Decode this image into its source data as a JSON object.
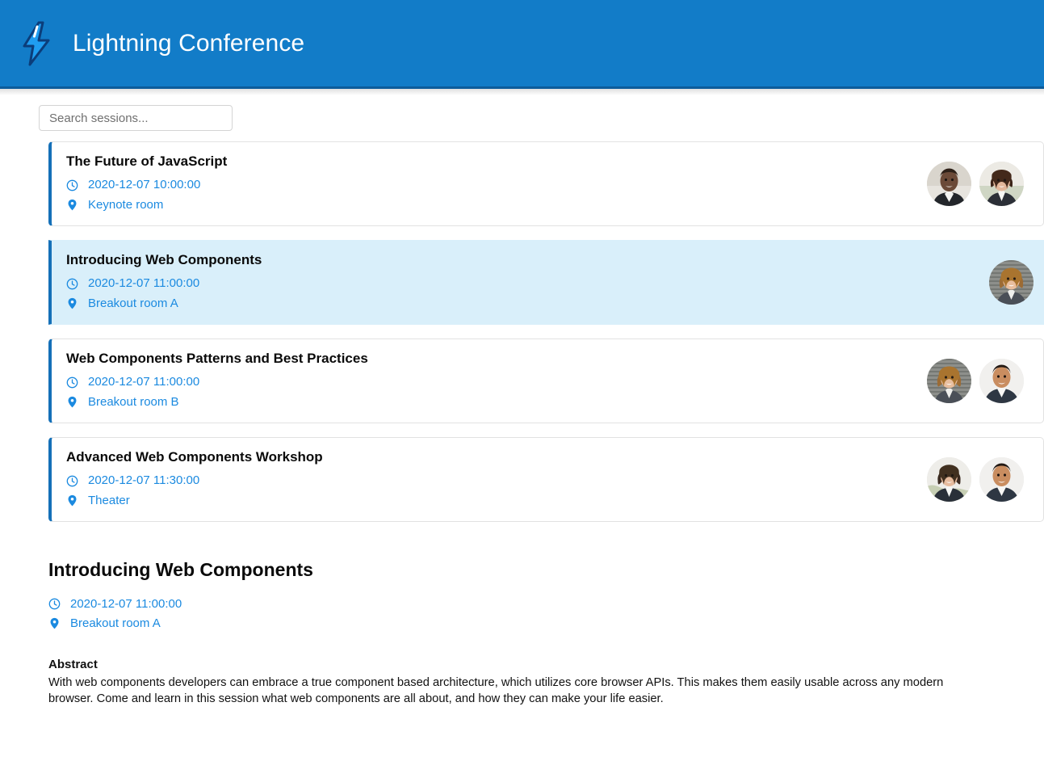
{
  "header": {
    "title": "Lightning Conference",
    "logo_icon": "lightning-bolt-icon",
    "bg_color": "#127cc8"
  },
  "search": {
    "placeholder": "Search sessions...",
    "value": "",
    "icon": "search-icon"
  },
  "icons": {
    "clock": "clock-icon",
    "location": "location-pin-icon"
  },
  "colors": {
    "accent": "#1570b8",
    "link": "#1b8ae0",
    "selected_bg": "#d9effa",
    "header_bg": "#127cc8"
  },
  "sessions": [
    {
      "title": "The Future of JavaScript",
      "datetime": "2020-12-07 10:00:00",
      "location": "Keynote room",
      "selected": false,
      "speakers": [
        "speaker-avatar-1",
        "speaker-avatar-2"
      ]
    },
    {
      "title": "Introducing Web Components",
      "datetime": "2020-12-07 11:00:00",
      "location": "Breakout room A",
      "selected": true,
      "speakers": [
        "speaker-avatar-3"
      ]
    },
    {
      "title": "Web Components Patterns and Best Practices",
      "datetime": "2020-12-07 11:00:00",
      "location": "Breakout room B",
      "selected": false,
      "speakers": [
        "speaker-avatar-3",
        "speaker-avatar-4"
      ]
    },
    {
      "title": "Advanced Web Components Workshop",
      "datetime": "2020-12-07 11:30:00",
      "location": "Theater",
      "selected": false,
      "speakers": [
        "speaker-avatar-5",
        "speaker-avatar-4"
      ]
    }
  ],
  "detail": {
    "title": "Introducing Web Components",
    "datetime": "2020-12-07 11:00:00",
    "location": "Breakout room A",
    "abstract_heading": "Abstract",
    "abstract": "With web components developers can embrace a true component based architecture, which utilizes core browser APIs. This makes them easily usable across any modern browser. Come and learn in this session what web components are all about, and how they can make your life easier."
  }
}
